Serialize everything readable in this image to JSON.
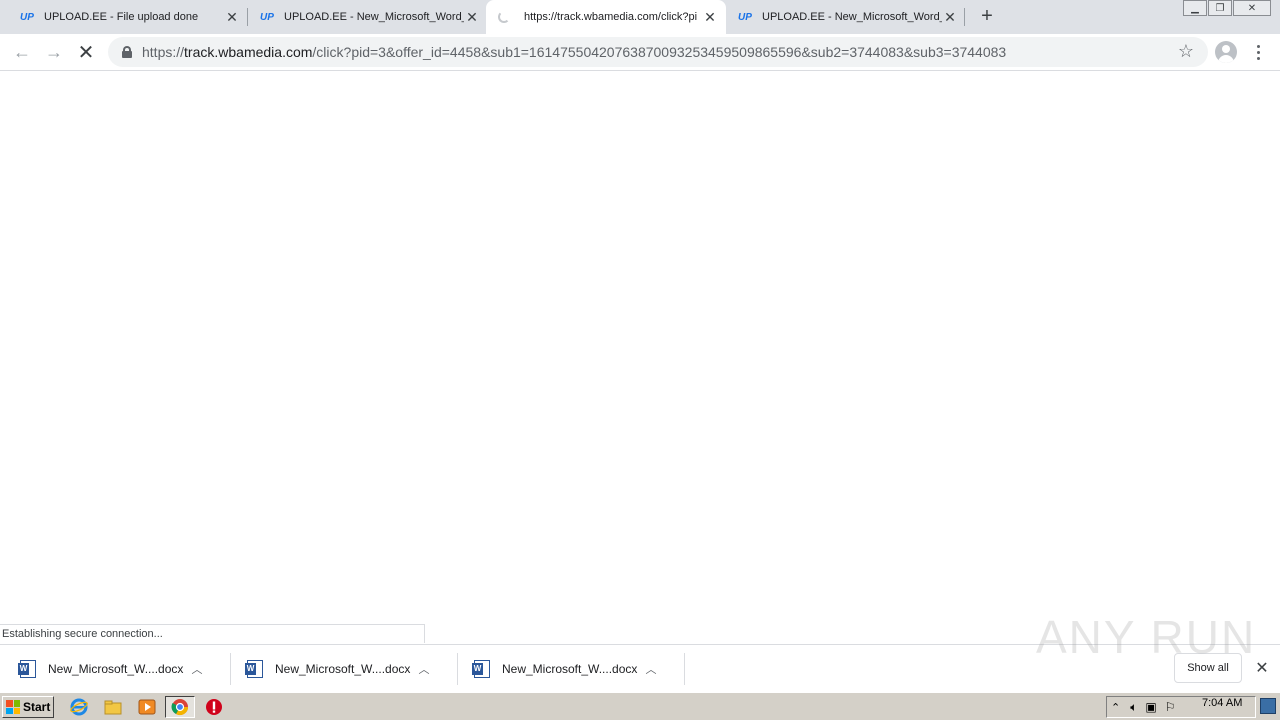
{
  "tabs": [
    {
      "favicon": "UP",
      "title": "UPLOAD.EE - File upload done",
      "active": false
    },
    {
      "favicon": "UP",
      "title": "UPLOAD.EE - New_Microsoft_Word_",
      "active": false
    },
    {
      "favicon": "loading-spinner",
      "title": "https://track.wbamedia.com/click?pi",
      "active": true
    },
    {
      "favicon": "UP",
      "title": "UPLOAD.EE - New_Microsoft_Word_",
      "active": false
    }
  ],
  "new_tab_label": "+",
  "address": {
    "scheme": "https://",
    "host": "track.wbamedia.com",
    "path": "/click?pid=3&offer_id=4458&sub1=16147550420763870093253459509865596&sub2=3744083&sub3=3744083"
  },
  "status_text": "Establishing secure connection...",
  "downloads": [
    {
      "name": "New_Microsoft_W....docx"
    },
    {
      "name": "New_Microsoft_W....docx"
    },
    {
      "name": "New_Microsoft_W....docx"
    }
  ],
  "show_all_label": "Show all",
  "watermark": "ANY RUN",
  "taskbar": {
    "start_label": "Start",
    "clock": "7:04 AM"
  },
  "colors": {
    "tabstrip": "#dee1e6",
    "omnibox": "#f1f3f4",
    "taskbar": "#d4d0c8",
    "accent": "#1a73e8"
  }
}
